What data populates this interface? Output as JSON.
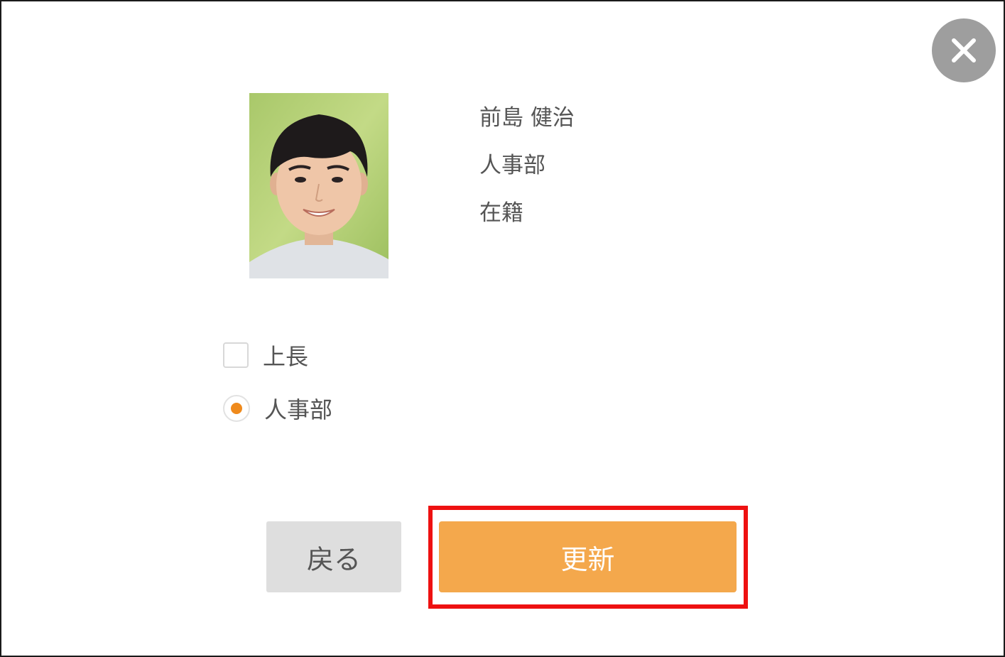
{
  "profile": {
    "name": "前島 健治",
    "department": "人事部",
    "status": "在籍",
    "photo_icon": "employee-photo"
  },
  "options": {
    "checkbox_label": "上長",
    "checkbox_checked": false,
    "radio_label": "人事部",
    "radio_selected": true
  },
  "buttons": {
    "back_label": "戻る",
    "update_label": "更新"
  },
  "icons": {
    "close": "close-icon"
  },
  "colors": {
    "accent": "#f4a84c",
    "radio_dot": "#ef8a1c",
    "highlight": "#ee1111",
    "close_bg": "#9e9e9e",
    "back_bg": "#dedede"
  }
}
